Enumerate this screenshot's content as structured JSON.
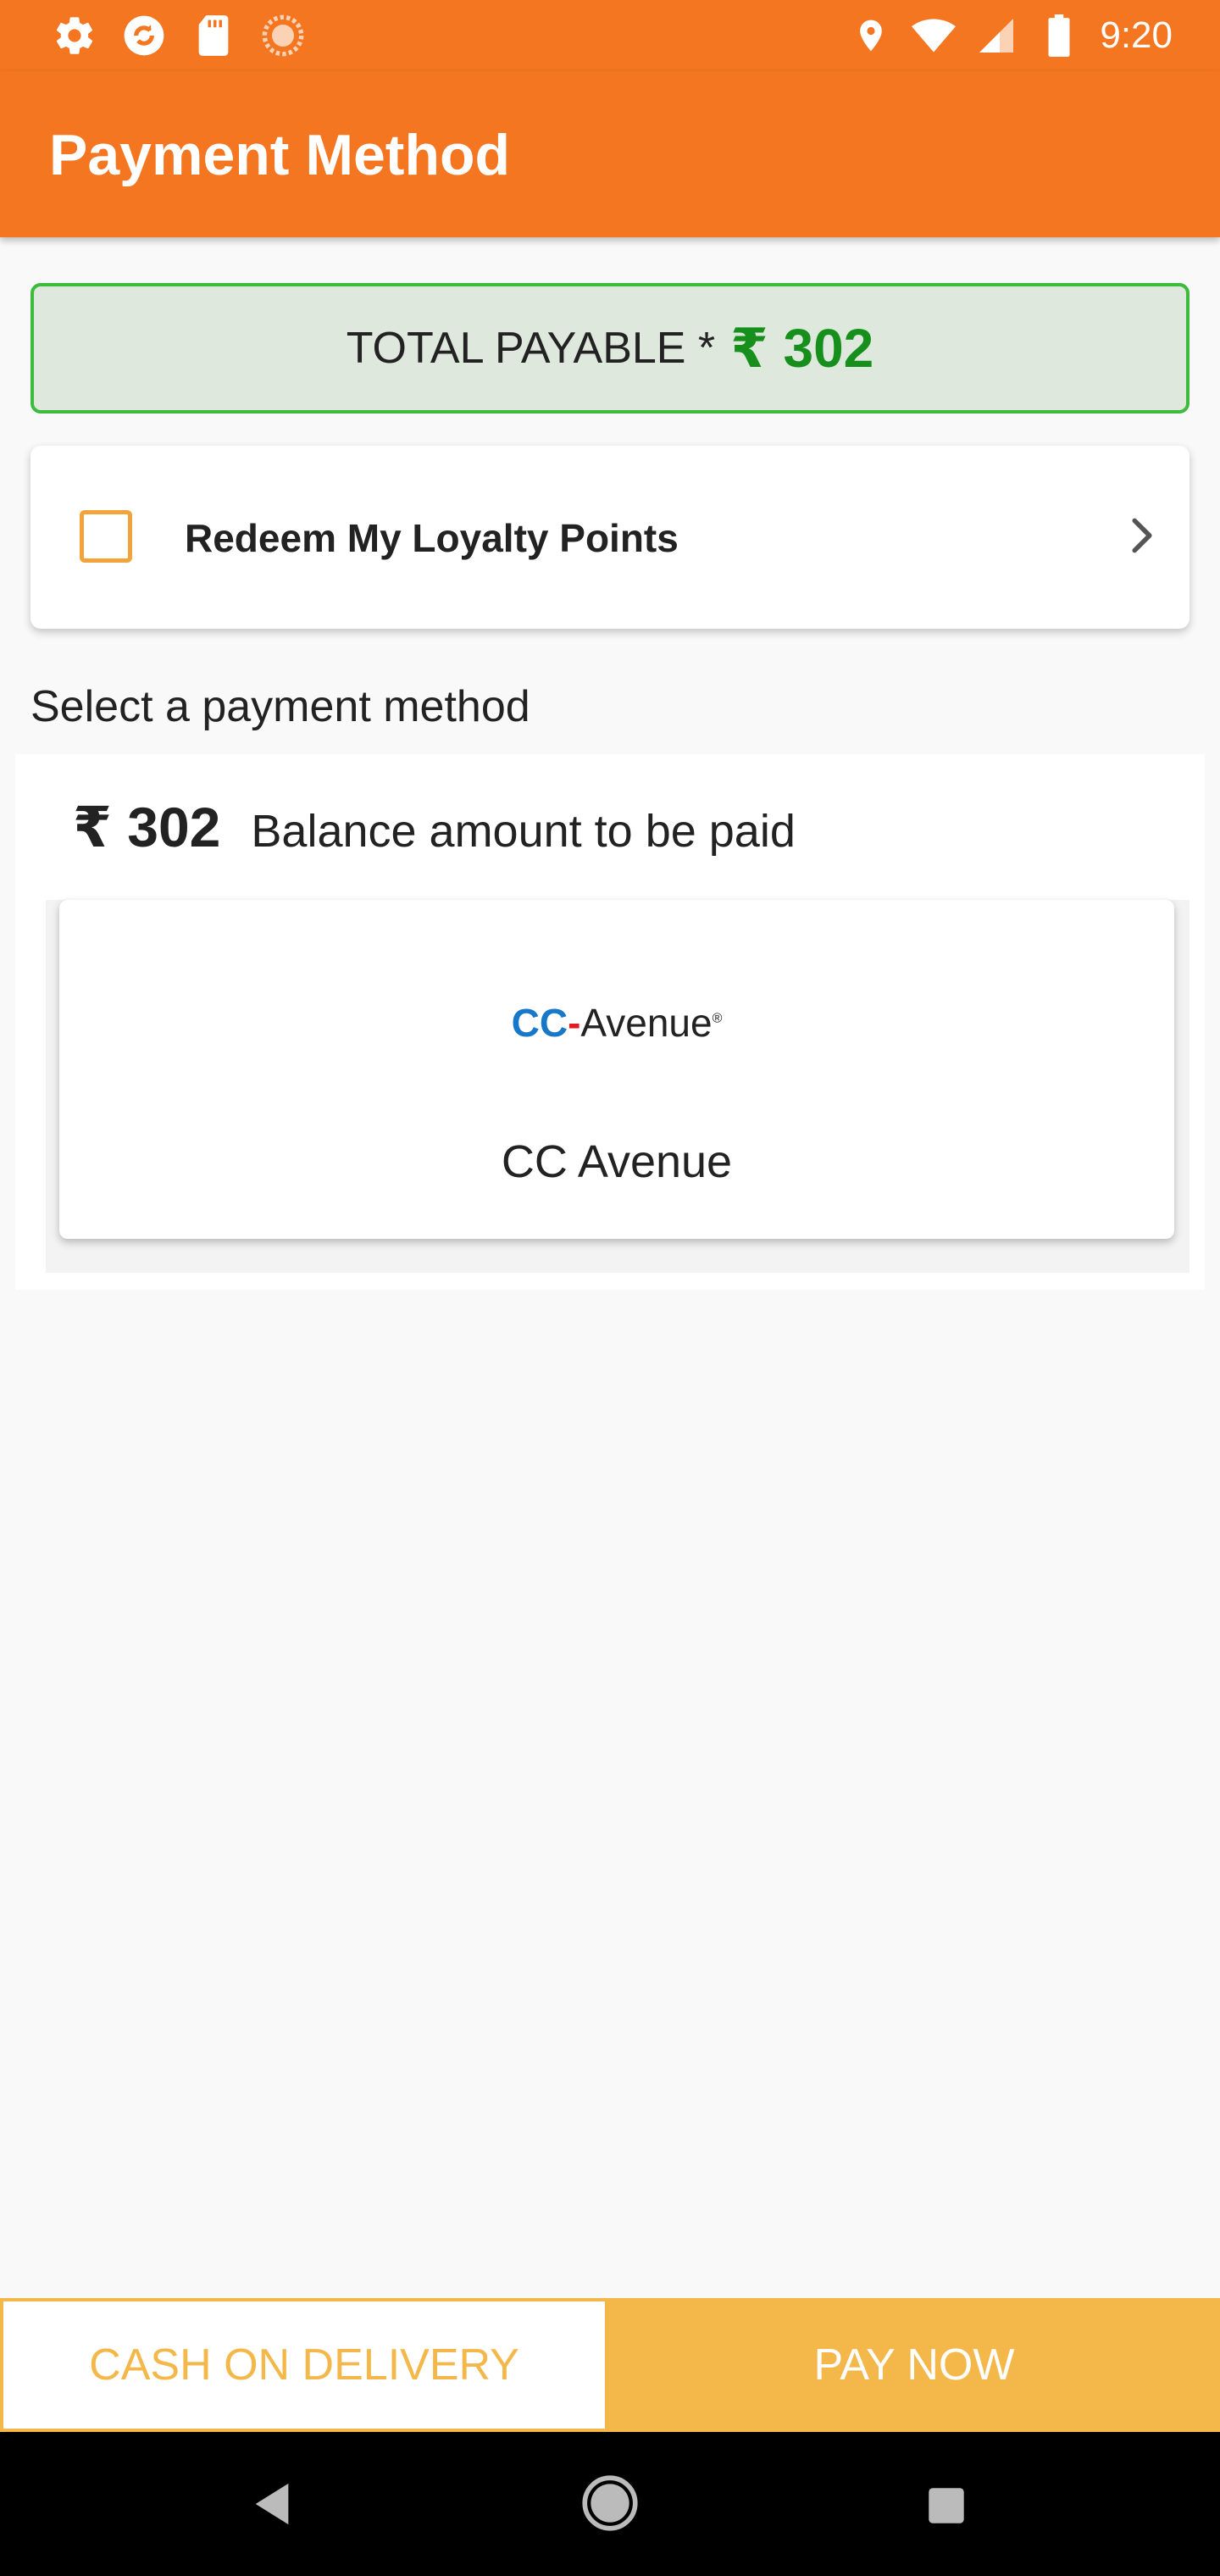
{
  "status_bar": {
    "time": "9:20",
    "left_icons": [
      "settings-icon",
      "sync-icon",
      "sd-card-icon",
      "circle-dots-icon"
    ],
    "right_icons": [
      "location-icon",
      "wifi-icon",
      "signal-icon",
      "battery-icon"
    ]
  },
  "app_bar": {
    "title": "Payment Method"
  },
  "total": {
    "label": "TOTAL PAYABLE *",
    "value": "₹ 302",
    "color": "#178f1d"
  },
  "loyalty": {
    "label": "Redeem My Loyalty Points",
    "checked": false
  },
  "section_heading": "Select a payment method",
  "balance": {
    "amount": "₹ 302",
    "label": "Balance amount to be paid"
  },
  "payment_methods": [
    {
      "name": "CC Avenue",
      "logo_text_cc": "CC",
      "logo_text_avenue": "Avenue",
      "logo_reg": "®"
    }
  ],
  "buttons": {
    "cod": "CASH ON DELIVERY",
    "pay_now": "PAY NOW"
  },
  "colors": {
    "primary": "#f47621",
    "accent": "#f4b84a",
    "success_border": "#3dbb3d"
  }
}
